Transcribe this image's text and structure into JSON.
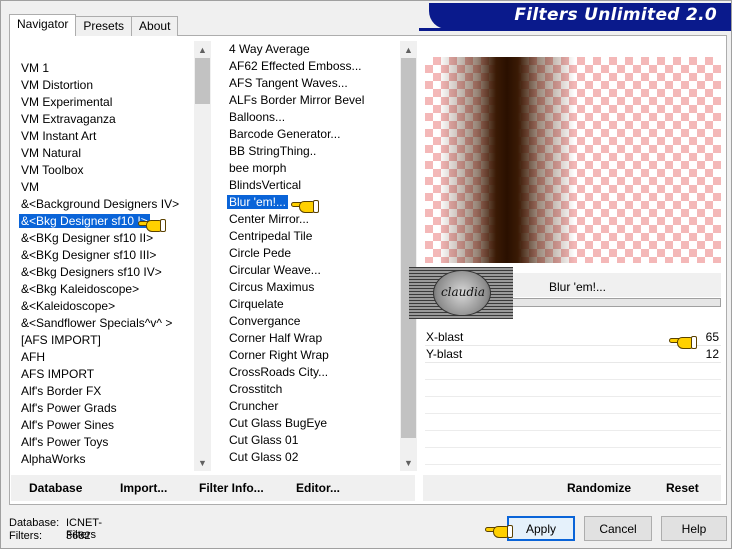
{
  "app": {
    "title": "Filters Unlimited 2.0"
  },
  "tabs": [
    {
      "label": "Navigator",
      "active": true
    },
    {
      "label": "Presets",
      "active": false
    },
    {
      "label": "About",
      "active": false
    }
  ],
  "categories": {
    "items": [
      "VM 1",
      "VM Distortion",
      "VM Experimental",
      "VM Extravaganza",
      "VM Instant Art",
      "VM Natural",
      "VM Toolbox",
      "VM",
      "&<Background Designers IV>",
      "&<Bkg Designer sf10 I>",
      "&<BKg Designer sf10 II>",
      "&<BKg Designer sf10 III>",
      "&<Bkg Designers sf10 IV>",
      "&<Bkg Kaleidoscope>",
      "&<Kaleidoscope>",
      "&<Sandflower Specials^v^ >",
      "[AFS IMPORT]",
      "AFH",
      "AFS IMPORT",
      "Alf's Border FX",
      "Alf's Power Grads",
      "Alf's Power Sines",
      "Alf's Power Toys",
      "AlphaWorks"
    ],
    "selected_index": 9
  },
  "filters": {
    "items": [
      "4 Way Average",
      "AF62 Effected Emboss...",
      "AFS Tangent Waves...",
      "ALFs Border Mirror Bevel",
      "Balloons...",
      "Barcode Generator...",
      "BB StringThing..",
      "bee morph",
      "BlindsVertical",
      "Blur 'em!...",
      "Center Mirror...",
      "Centripedal Tile",
      "Circle Pede",
      "Circular Weave...",
      "Circus Maximus",
      "Cirquelate",
      "Convergance",
      "Corner Half Wrap",
      "Corner Right Wrap",
      "CrossRoads City...",
      "Crosstitch",
      "Cruncher",
      "Cut Glass  BugEye",
      "Cut Glass 01",
      "Cut Glass 02"
    ],
    "selected_index": 9
  },
  "preview": {
    "filter_name": "Blur 'em!...",
    "watermark_text": "claudia"
  },
  "params": [
    {
      "name": "X-blast",
      "value": "65"
    },
    {
      "name": "Y-blast",
      "value": "12"
    }
  ],
  "left_buttons": {
    "database": "Database",
    "import": "Import...",
    "filter_info": "Filter Info...",
    "editor": "Editor..."
  },
  "right_buttons": {
    "randomize": "Randomize",
    "reset": "Reset"
  },
  "status": {
    "database_label": "Database:",
    "database_value": "ICNET-Filters",
    "filters_label": "Filters:",
    "filters_value": "3682"
  },
  "dialog_buttons": {
    "apply": "Apply",
    "cancel": "Cancel",
    "help": "Help"
  },
  "colors": {
    "banner": "#0a1a8c",
    "selection": "#0a64d8",
    "checker": "#f4b8b8",
    "pointer_hand": "#ffd000"
  },
  "icons": [
    "pointing-hand-icon",
    "scroll-up-icon",
    "scroll-down-icon"
  ]
}
